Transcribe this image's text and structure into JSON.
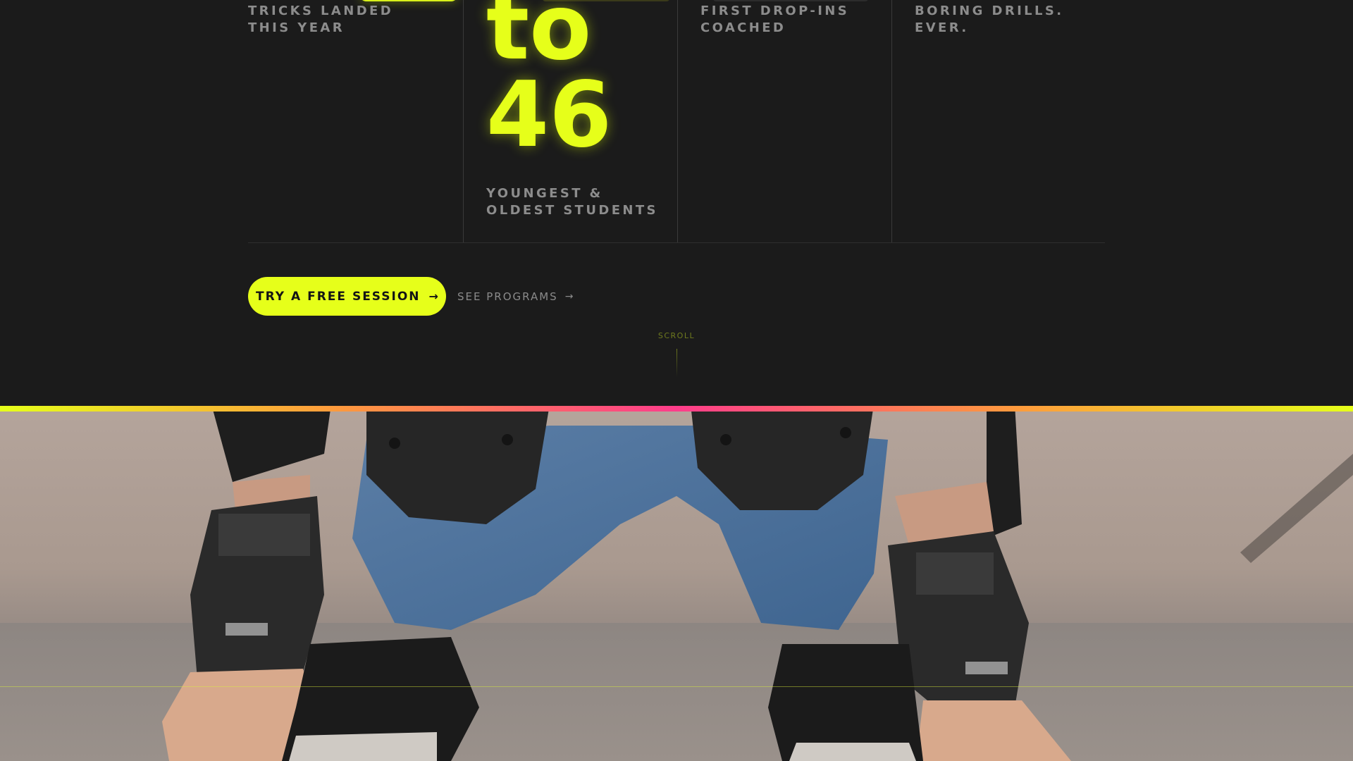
{
  "stats": [
    {
      "label": "Tricks landed this year"
    },
    {
      "value_line1": "to",
      "value_line2": "46",
      "label": "Youngest & oldest students"
    },
    {
      "label": "First drop-ins coached"
    },
    {
      "label": "Boring drills. Ever."
    }
  ],
  "cta": {
    "primary_label": "Try a free session",
    "primary_icon": "arrow-right-icon",
    "secondary_label": "See programs",
    "secondary_icon": "arrow-right-icon"
  },
  "scroll": {
    "label": "Scroll"
  },
  "colors": {
    "background": "#1b1b1b",
    "accent": "#e6ff1a",
    "muted_text": "#8c8c8c",
    "gradient": [
      "#e6ff1a",
      "#ff9a3d",
      "#ff3d8b"
    ]
  },
  "photo": {
    "subject": "child-skater-with-protective-gear-icon"
  }
}
